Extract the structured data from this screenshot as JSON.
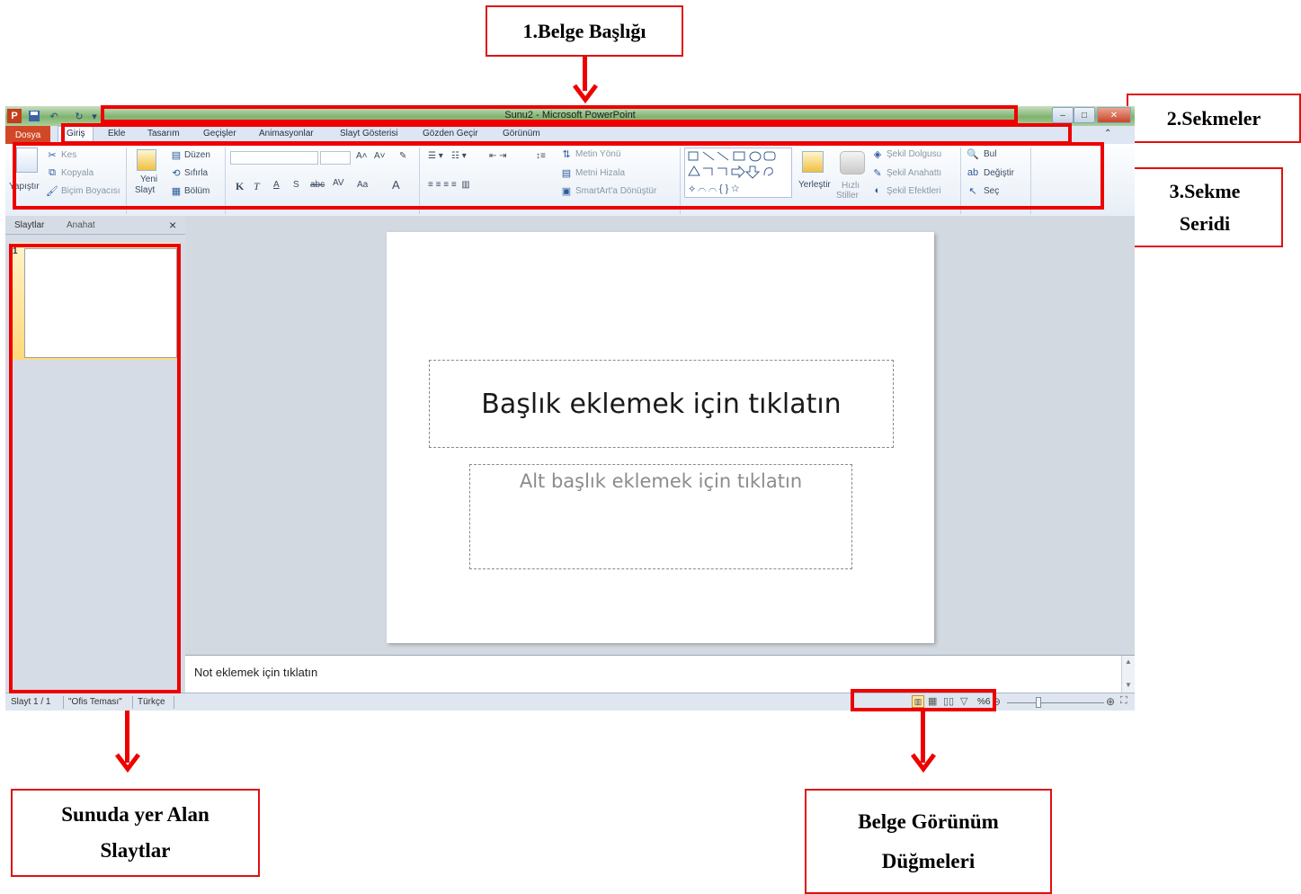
{
  "annotations": {
    "document_title": "1.Belge Başlığı",
    "tabs": "2.Sekmeler",
    "ribbon_line1": "3.Sekme",
    "ribbon_line2": "Seridi",
    "slides_line1": "Sunuda yer Alan",
    "slides_line2": "Slaytlar",
    "views_line1": "Belge Görünüm",
    "views_line2": "Düğmeleri"
  },
  "window": {
    "title": "Sunu2 - Microsoft PowerPoint",
    "app_icon": "P"
  },
  "tabs": {
    "file": "Dosya",
    "items": [
      "Giriş",
      "Ekle",
      "Tasarım",
      "Geçişler",
      "Animasyonlar",
      "Slayt Gösterisi",
      "Gözden Geçir",
      "Görünüm"
    ]
  },
  "ribbon": {
    "clipboard": {
      "paste": "Yapıştır",
      "cut": "Kes",
      "copy": "Kopyala",
      "format_painter": "Biçim Boyacısı"
    },
    "slides": {
      "new_slide_1": "Yeni",
      "new_slide_2": "Slayt",
      "layout": "Düzen",
      "reset": "Sıfırla",
      "section": "Bölüm"
    },
    "font": {
      "bold": "K",
      "italic": "T",
      "underline": "A",
      "shadow": "S",
      "strike": "abc",
      "spacing": "AV",
      "case": "Aa",
      "color": "A"
    },
    "paragraph": {
      "text_direction": "Metin Yönü",
      "align_text": "Metni Hizala",
      "smartart": "SmartArt'a Dönüştür"
    },
    "drawing": {
      "arrange": "Yerleştir",
      "quick_styles_1": "Hızlı",
      "quick_styles_2": "Stiller",
      "fill": "Şekil Dolgusu",
      "outline": "Şekil Anahattı",
      "effects": "Şekil Efektleri"
    },
    "editing": {
      "find": "Bul",
      "replace": "Değiştir",
      "select": "Seç"
    }
  },
  "left_pane": {
    "tab_slides": "Slaytlar",
    "tab_outline": "Anahat",
    "close": "×",
    "slide_number": "1"
  },
  "slide": {
    "title_placeholder": "Başlık eklemek için tıklatın",
    "subtitle_placeholder": "Alt başlık eklemek için tıklatın"
  },
  "notes": {
    "placeholder": "Not eklemek için tıklatın"
  },
  "status": {
    "slide_count": "Slayt 1 / 1",
    "theme": "\"Ofis Teması\"",
    "language": "Türkçe",
    "zoom": "%6"
  }
}
